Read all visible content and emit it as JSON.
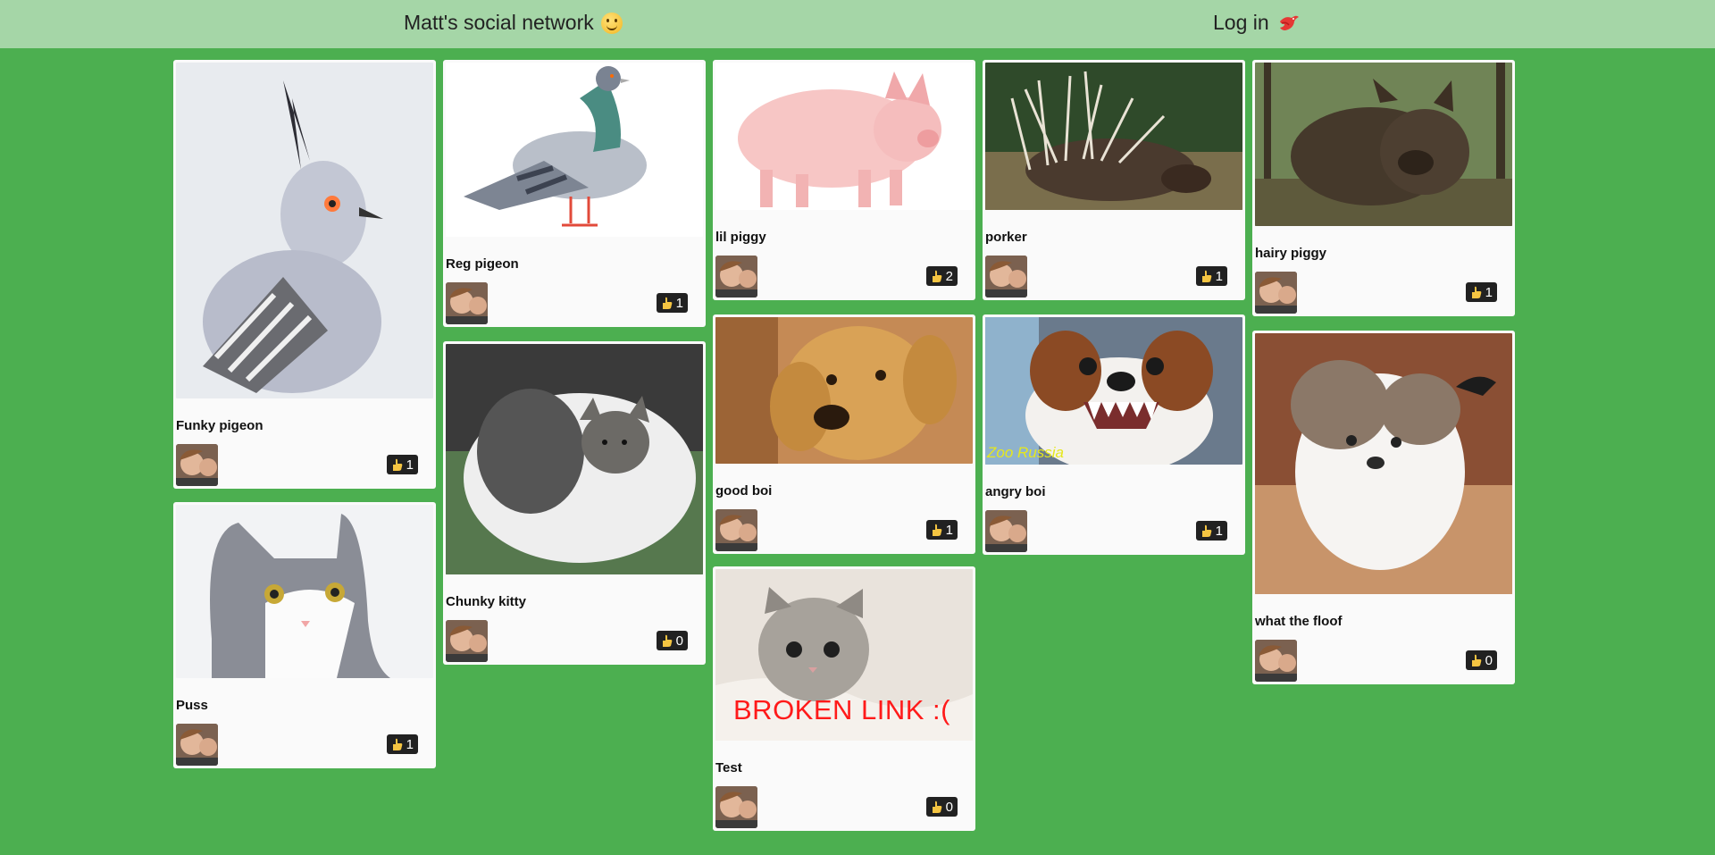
{
  "header": {
    "title": "Matt's social network",
    "title_icon": "smile-icon",
    "login_label": "Log in",
    "login_icon": "bird-icon"
  },
  "colors": {
    "background": "#4caf50",
    "topbar": "#a5d6a7",
    "card": "#fafafa",
    "badge": "#212121"
  },
  "posts": [
    {
      "caption": "Funky pigeon",
      "likes": "1"
    },
    {
      "caption": "Puss",
      "likes": "1"
    },
    {
      "caption": "Reg pigeon",
      "likes": "1"
    },
    {
      "caption": "Chunky kitty",
      "likes": "0"
    },
    {
      "caption": "lil piggy",
      "likes": "2"
    },
    {
      "caption": "good boi",
      "likes": "1"
    },
    {
      "caption": "Test",
      "likes": "0",
      "image_text": "BROKEN LINK :("
    },
    {
      "caption": "porker",
      "likes": "1"
    },
    {
      "caption": "angry boi",
      "likes": "1",
      "image_text": "Zoo Russia"
    },
    {
      "caption": "hairy piggy",
      "likes": "1"
    },
    {
      "caption": "what the floof",
      "likes": "0"
    }
  ]
}
